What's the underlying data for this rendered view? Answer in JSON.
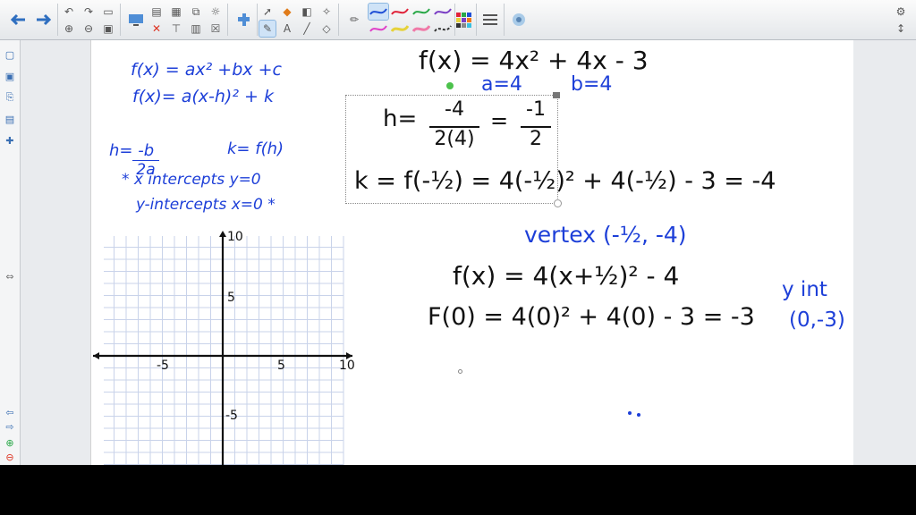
{
  "toolbar": {
    "icons": [
      "back-arrow-icon",
      "forward-arrow-icon",
      "undo-icon",
      "redo-icon",
      "save-icon",
      "screen-icon",
      "paste-icon",
      "clear-icon",
      "delete-icon",
      "table-icon",
      "capture-icon",
      "select-arrow-icon",
      "pen-icon",
      "eraser-icon",
      "line-icon",
      "fill-icon",
      "text-icon",
      "shape-icon",
      "color-palette-icon",
      "line-style-icon",
      "properties-icon",
      "settings-icon"
    ]
  },
  "colors": {
    "ink_blue": "#1d3fd8",
    "ink_black": "#111111",
    "grid": "#c9d3ea"
  },
  "notes": {
    "form1": "f(x) = ax² +bx +c",
    "form2": "f(x)= a(x-h)² + k",
    "h_label": "h= -b",
    "h_den": "2a",
    "k_label": "k= f(h)",
    "xint": "* x intercepts y=0",
    "yint": "y-intercepts  x=0 *"
  },
  "work": {
    "equation": "f(x) = 4x² + 4x - 3",
    "a_val": "a=4",
    "b_val": "b=4",
    "h_left": "h=",
    "h_num": "-4",
    "h_den": "2(4)",
    "h_eq": "=",
    "h_res_num": "-1",
    "h_res_den": "2",
    "k_line": "k = f(-½) = 4(-½)² + 4(-½) - 3 = -4",
    "vertex": "vertex (-½, -4)",
    "vertex_form": "f(x) = 4(x+½)² - 4",
    "f0": "F(0) = 4(0)² + 4(0) - 3 = -3",
    "yint_label": "y int",
    "yint_point": "(0,-3)"
  },
  "graph": {
    "tick_labels": [
      "10",
      "5",
      "-5",
      "5",
      "10",
      "-5"
    ]
  }
}
